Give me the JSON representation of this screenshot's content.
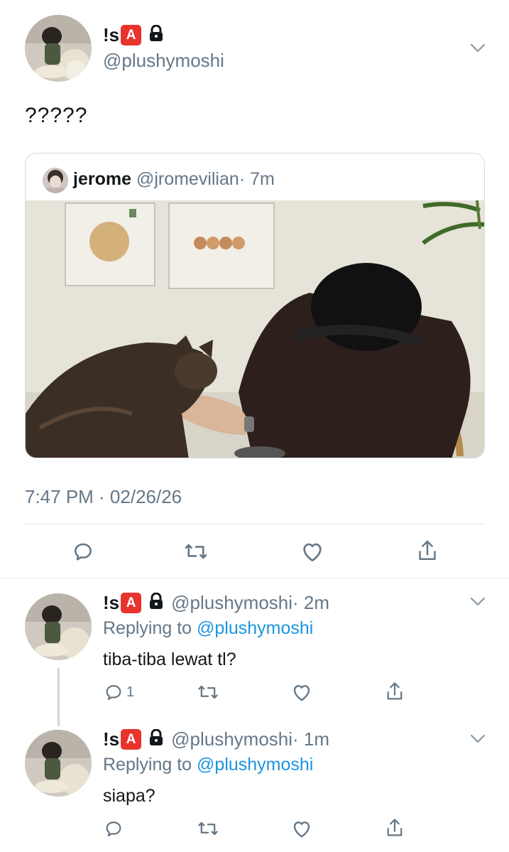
{
  "main_tweet": {
    "display_name_prefix": "!s",
    "badge_letter": "A",
    "handle": "@plushymoshi",
    "text": "?????",
    "timestamp": "7:47 PM · 02/26/26"
  },
  "quoted_tweet": {
    "name": "jerome",
    "handle": "@jromevilian",
    "age": "· 7m"
  },
  "replies": [
    {
      "display_name_prefix": "!s",
      "badge_letter": "A",
      "handle": "@plushymoshi",
      "age": "· 2m",
      "replying_prefix": "Replying to ",
      "replying_to": "@plushymoshi",
      "text": "tiba-tiba lewat tl?",
      "reply_count": "1"
    },
    {
      "display_name_prefix": "!s",
      "badge_letter": "A",
      "handle": "@plushymoshi",
      "age": "· 1m",
      "replying_prefix": "Replying to ",
      "replying_to": "@plushymoshi",
      "text": "siapa?",
      "reply_count": ""
    }
  ],
  "colors": {
    "link_blue": "#1b95e0",
    "muted_gray": "#657786",
    "badge_red": "#e8342d"
  },
  "icons": [
    "chevron-down-icon",
    "lock-icon",
    "reply-icon",
    "retweet-icon",
    "like-icon",
    "share-icon"
  ]
}
